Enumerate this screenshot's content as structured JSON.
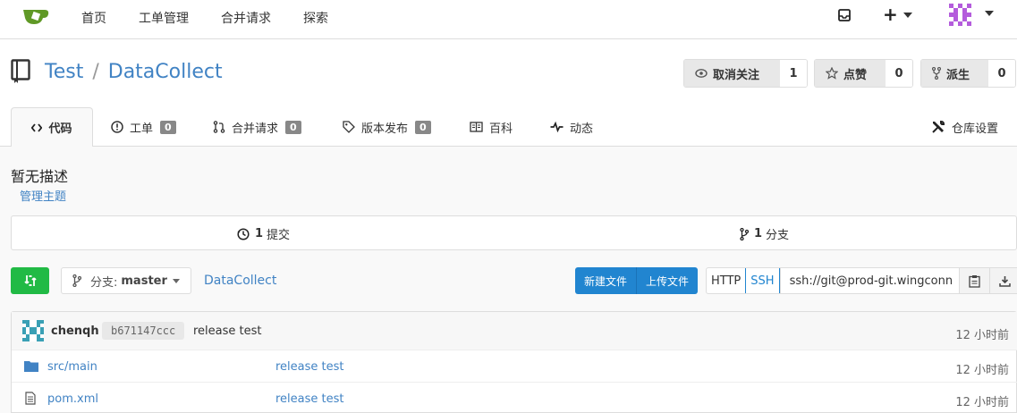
{
  "nav": {
    "links": [
      "首页",
      "工单管理",
      "合并请求",
      "探索"
    ],
    "plus_label": "+"
  },
  "repo": {
    "owner": "Test",
    "separator": "/",
    "name": "DataCollect",
    "unwatch_label": "取消关注",
    "watch_count": "1",
    "star_label": "点赞",
    "star_count": "0",
    "fork_label": "派生",
    "fork_count": "0"
  },
  "tabs": {
    "code": "代码",
    "issues": "工单",
    "issues_count": "0",
    "pulls": "合并请求",
    "pulls_count": "0",
    "releases": "版本发布",
    "releases_count": "0",
    "wiki": "百科",
    "activity": "动态",
    "settings": "仓库设置"
  },
  "description": "暂无描述",
  "manage_topics": "管理主题",
  "stats": {
    "commits_num": "1",
    "commits_label": "提交",
    "branches_num": "1",
    "branches_label": "分支"
  },
  "toolbar": {
    "branch_prefix": "分支:",
    "branch_name": "master",
    "breadcrumb": "DataCollect",
    "new_file": "新建文件",
    "upload_file": "上传文件",
    "http": "HTTP",
    "ssh": "SSH",
    "clone_url": "ssh://git@prod-git.wingconn"
  },
  "latest_commit": {
    "author": "chenqh",
    "sha": "b671147ccc",
    "message": "release test",
    "time": "12 小时前"
  },
  "files": [
    {
      "name": "src/main",
      "type": "folder",
      "message": "release test",
      "time": "12 小时前"
    },
    {
      "name": "pom.xml",
      "type": "file",
      "message": "release test",
      "time": "12 小时前"
    }
  ],
  "colors": {
    "accent": "#4183c4",
    "green": "#21ba45",
    "blue": "#2185d0"
  }
}
